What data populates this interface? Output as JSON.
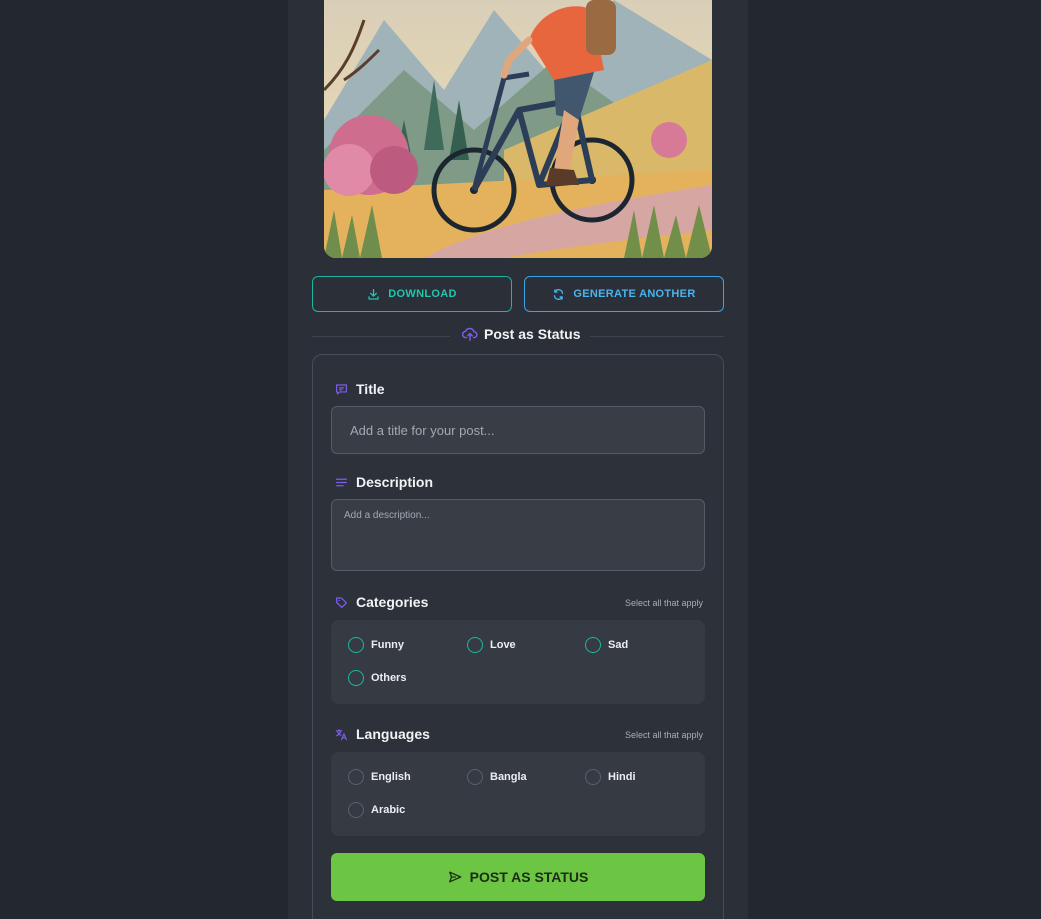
{
  "actions": {
    "download_label": "DOWNLOAD",
    "generate_label": "GENERATE ANOTHER"
  },
  "section": {
    "title": "Post as Status"
  },
  "form": {
    "title_label": "Title",
    "title_placeholder": "Add a title for your post...",
    "description_label": "Description",
    "description_placeholder": "Add a description...",
    "categories": {
      "label": "Categories",
      "hint": "Select all that apply",
      "options": [
        "Funny",
        "Love",
        "Sad",
        "Others"
      ]
    },
    "languages": {
      "label": "Languages",
      "hint": "Select all that apply",
      "options": [
        "English",
        "Bangla",
        "Hindi",
        "Arabic"
      ]
    },
    "submit_label": "POST AS STATUS"
  },
  "colors": {
    "background": "#23272f",
    "panel": "#2b2f37",
    "teal_accent": "#22c5ae",
    "blue_accent": "#49b4f0",
    "icon_purple": "#7c5cf0",
    "submit_green": "#6cc644"
  },
  "icons": {
    "download": "download-icon",
    "generate": "refresh-icon",
    "section": "upload-cloud-icon",
    "title": "message-icon",
    "description": "lines-icon",
    "categories": "tag-icon",
    "languages": "translate-icon",
    "submit": "send-icon"
  }
}
